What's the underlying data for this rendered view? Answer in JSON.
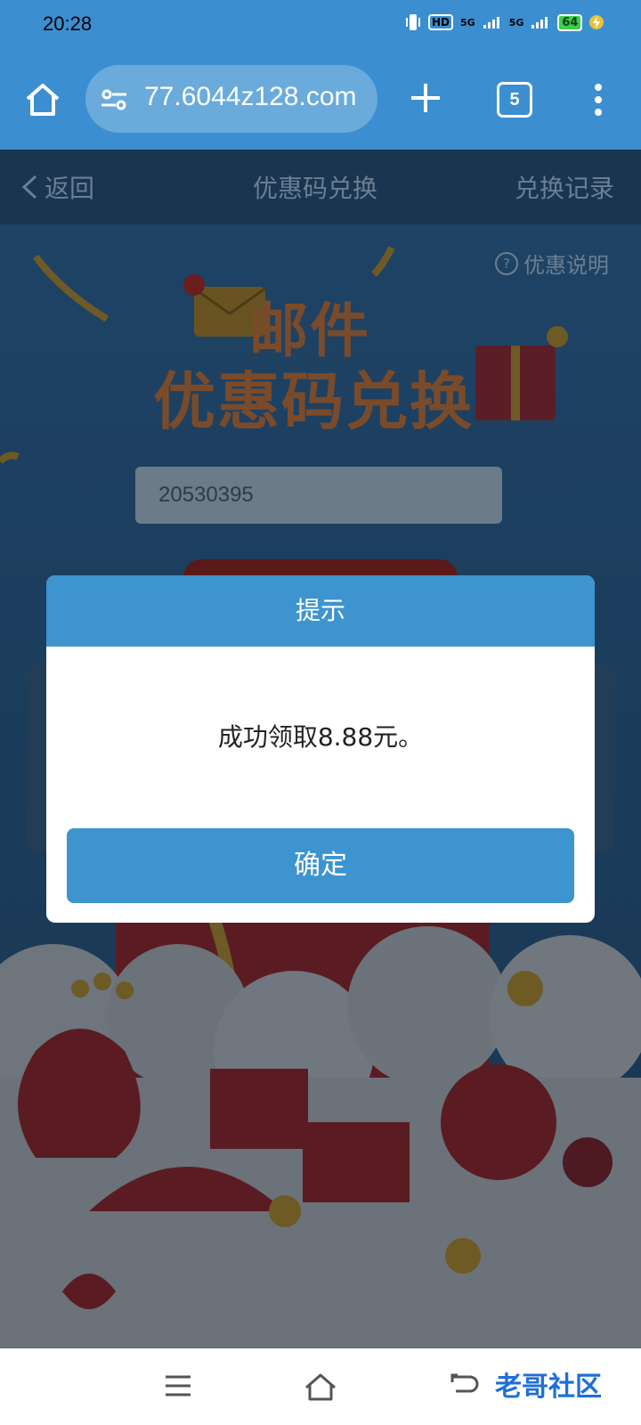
{
  "status_bar": {
    "time": "20:28",
    "hd_label": "HD",
    "network_1": "5G",
    "network_2": "5G",
    "battery": "64"
  },
  "browser": {
    "url": "77.6044z128.com",
    "tab_count": "5"
  },
  "page": {
    "nav": {
      "back_label": "返回",
      "title": "优惠码兑换",
      "records_label": "兑换记录"
    },
    "help_label": "优惠说明",
    "headline_line1": "邮件",
    "headline_line2": "优惠码兑换",
    "code_input_value": "20530395"
  },
  "dialog": {
    "title": "提示",
    "message": "成功领取8.88元。",
    "ok_label": "确定"
  },
  "watermark": {
    "text": "老哥社区"
  }
}
